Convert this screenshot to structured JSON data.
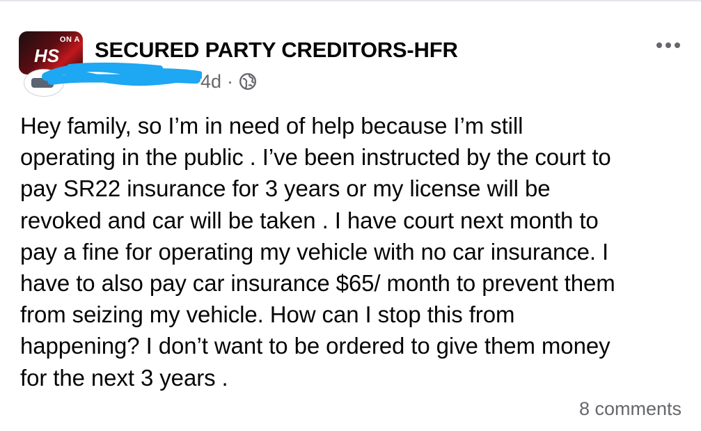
{
  "post": {
    "group_name": "SECURED PARTY CREDITORS-HFR",
    "group_avatar_text": "ON A",
    "group_avatar_mark": "HS",
    "timestamp": "4d",
    "separator": "·",
    "privacy_icon": "globe-icon",
    "more_icon": "more-dots-icon",
    "author_name_redacted": true,
    "body": "Hey family, so I’m in need of help because I’m still\noperating in the public . I’ve been instructed by the court to\npay SR22 insurance for 3 years or my license will be\nrevoked and car will be taken . I have court next month to\npay a fine for operating my vehicle with no car insurance. I\nhave to also pay car insurance $65/ month to prevent them\nfrom seizing my vehicle. How can I stop this from\nhappening? I don’t want to be ordered to give them money\nfor the next 3 years .",
    "comments_label": "8 comments"
  },
  "colors": {
    "text_primary": "#050505",
    "text_secondary": "#65676b",
    "redaction_scribble": "#1ea7f2"
  }
}
